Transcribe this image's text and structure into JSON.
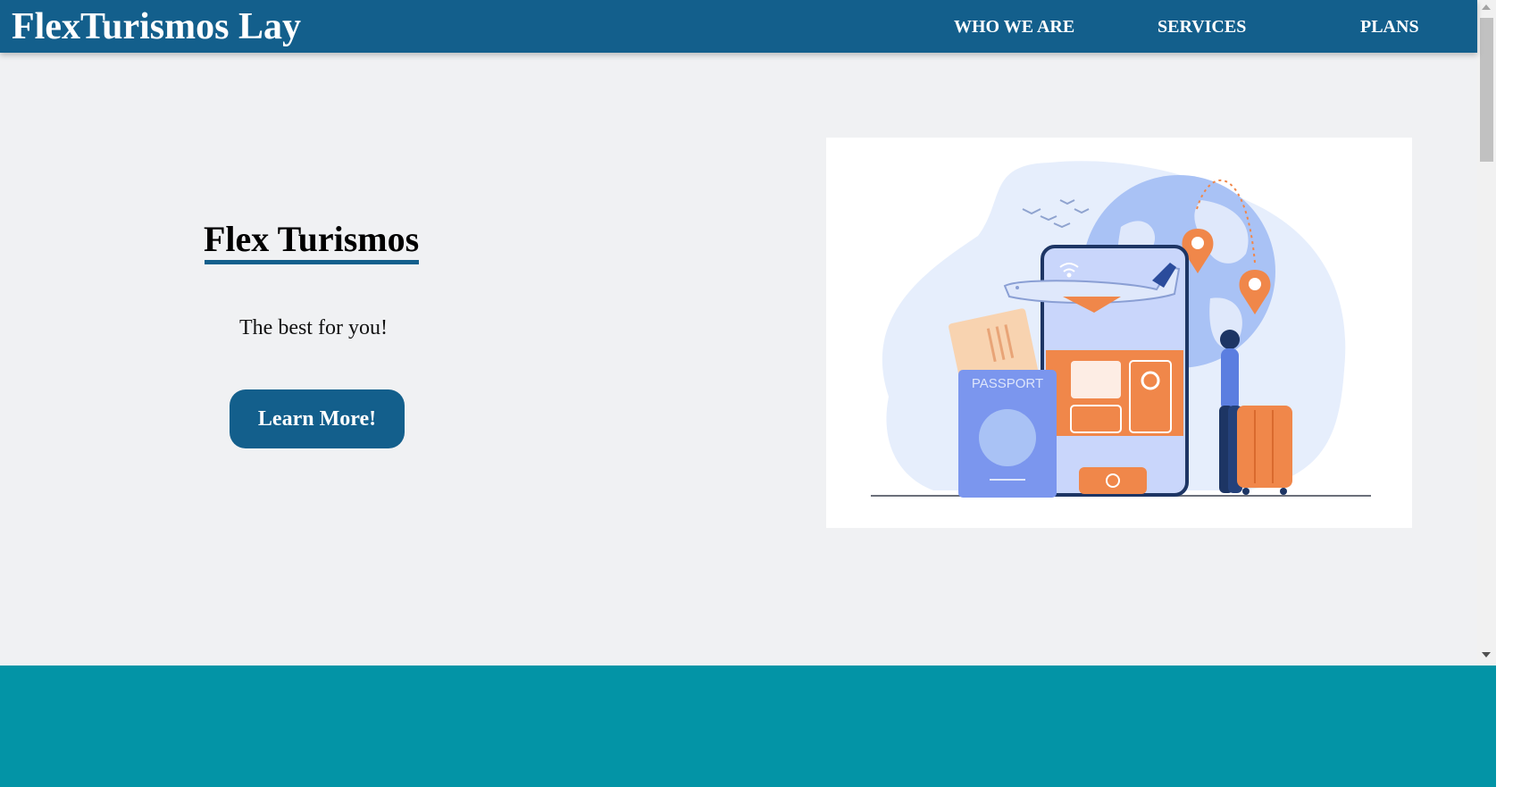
{
  "header": {
    "brand": "FlexTurismos Lay",
    "nav": [
      "WHO WE ARE",
      "SERVICES",
      "PLANS"
    ]
  },
  "hero": {
    "title": "Flex Turismos",
    "subtitle": "The best for you!",
    "cta_label": "Learn More!",
    "illustration": {
      "passport_text": "PASSPORT"
    }
  },
  "colors": {
    "nav_background": "#135f8c",
    "page_background": "#f0f1f3",
    "accent": "#135f8c",
    "footer_band": "#0394a6",
    "illustration_orange": "#f0874a",
    "illustration_blue": "#7b96ee"
  },
  "icons": [
    "wifi-icon",
    "airplane-icon",
    "location-pin-icon",
    "globe-icon",
    "suitcase-icon",
    "check-icon"
  ]
}
